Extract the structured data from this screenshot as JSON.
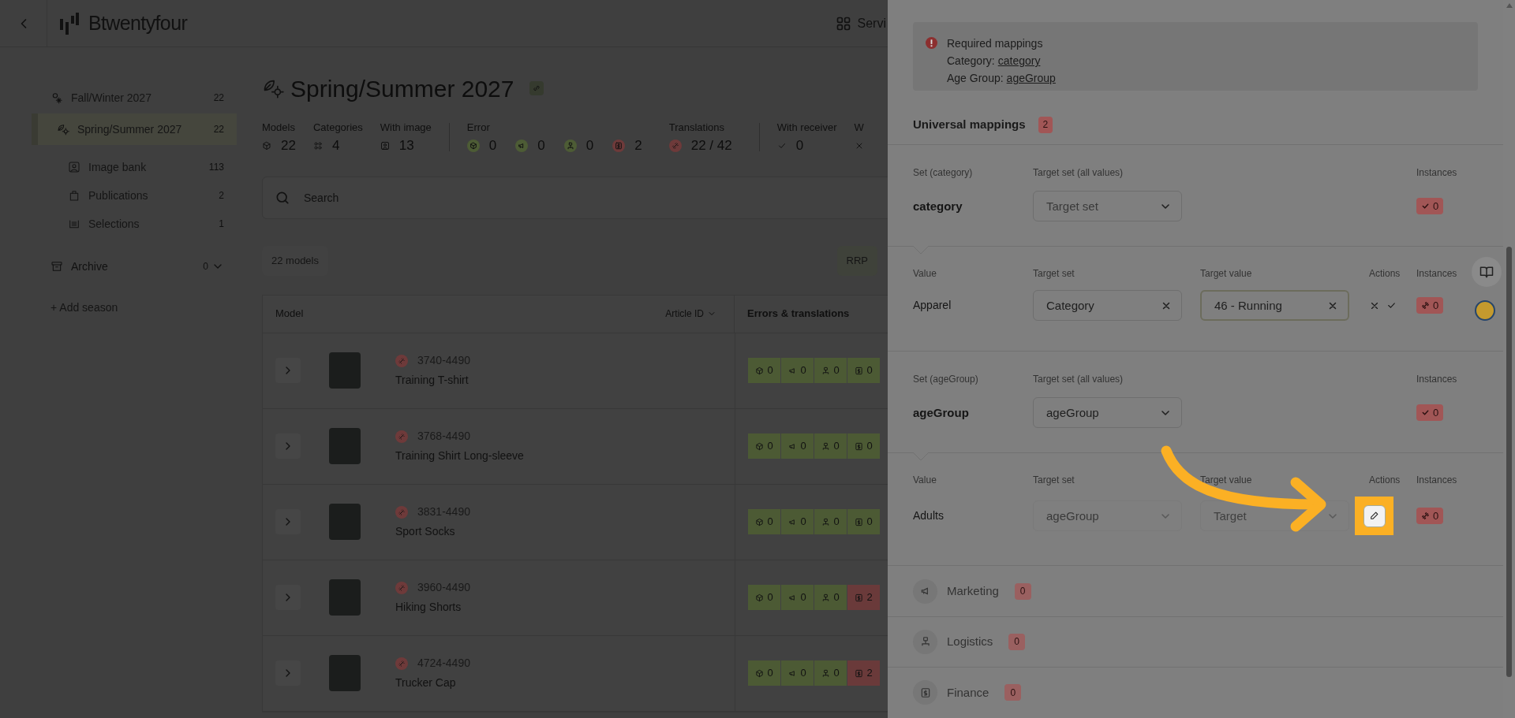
{
  "header": {
    "logo": "Btwentyfour",
    "services": "Servi"
  },
  "sidebar": {
    "seasons": [
      {
        "label": "Fall/Winter 2027",
        "count": "22",
        "selected": false
      },
      {
        "label": "Spring/Summer 2027",
        "count": "22",
        "selected": true
      }
    ],
    "sub_items": [
      {
        "label": "Image bank",
        "count": "113"
      },
      {
        "label": "Publications",
        "count": "2"
      },
      {
        "label": "Selections",
        "count": "1"
      }
    ],
    "archive": {
      "label": "Archive",
      "count": "0"
    },
    "add_season": "+ Add season"
  },
  "page": {
    "title": "Spring/Summer 2027",
    "stats": [
      {
        "kind": "count",
        "label": "Models",
        "value": "22"
      },
      {
        "kind": "count",
        "label": "Categories",
        "value": "4"
      },
      {
        "kind": "count",
        "label": "With image",
        "value": "13"
      },
      {
        "kind": "status",
        "label": "Error",
        "items": [
          {
            "value": "0",
            "color": "#4d5c35"
          },
          {
            "value": "0",
            "color": "#4d5c35"
          },
          {
            "value": "0",
            "color": "#4d5c35"
          },
          {
            "value": "2",
            "color": "#6e3a3a"
          }
        ]
      },
      {
        "kind": "status",
        "label": "Translations",
        "items": [
          {
            "value": "22 / 42",
            "color": "#6e3a3a"
          }
        ]
      },
      {
        "kind": "count",
        "label": "With receiver",
        "value": "0"
      },
      {
        "kind": "count",
        "label": "W"
      }
    ],
    "search": {
      "placeholder": "Search"
    },
    "model_count": "22 models",
    "price_button": "RRP",
    "table": {
      "columns": [
        "Model",
        "Article ID",
        "Errors & translations"
      ],
      "rows": [
        {
          "article_id": "3740-4490",
          "name": "Training T-shirt",
          "chips": [
            {
              "value": "0",
              "color": "#4c5a34"
            },
            {
              "value": "0",
              "color": "#4c5a34"
            },
            {
              "value": "0",
              "color": "#4c5a34"
            },
            {
              "value": "0",
              "color": "#4c5a34"
            }
          ]
        },
        {
          "article_id": "3768-4490",
          "name": "Training Shirt Long-sleeve",
          "chips": [
            {
              "value": "0",
              "color": "#4c5a34"
            },
            {
              "value": "0",
              "color": "#4c5a34"
            },
            {
              "value": "0",
              "color": "#4c5a34"
            },
            {
              "value": "0",
              "color": "#4c5a34"
            }
          ]
        },
        {
          "article_id": "3831-4490",
          "name": "Sport Socks",
          "chips": [
            {
              "value": "0",
              "color": "#4c5a34"
            },
            {
              "value": "0",
              "color": "#4c5a34"
            },
            {
              "value": "0",
              "color": "#4c5a34"
            },
            {
              "value": "0",
              "color": "#4c5a34"
            }
          ]
        },
        {
          "article_id": "3960-4490",
          "name": "Hiking Shorts",
          "chips": [
            {
              "value": "0",
              "color": "#4c5a34"
            },
            {
              "value": "0",
              "color": "#4c5a34"
            },
            {
              "value": "0",
              "color": "#4c5a34"
            },
            {
              "value": "2",
              "color": "#6a3a3a"
            }
          ]
        },
        {
          "article_id": "4724-4490",
          "name": "Trucker Cap",
          "chips": [
            {
              "value": "0",
              "color": "#4c5a34"
            },
            {
              "value": "0",
              "color": "#4c5a34"
            },
            {
              "value": "0",
              "color": "#4c5a34"
            },
            {
              "value": "2",
              "color": "#6a3a3a"
            }
          ]
        }
      ]
    }
  },
  "panel": {
    "alert": {
      "title": "Required mappings",
      "lines": [
        {
          "label": "Category:",
          "link": "category"
        },
        {
          "label": "Age Group:",
          "link": "ageGroup"
        }
      ]
    },
    "section": {
      "title": "Universal mappings",
      "count": "2"
    },
    "groups": [
      {
        "set_label": "Set (category)",
        "target_label": "Target set (all values)",
        "instances_label": "Instances",
        "name": "category",
        "target_set": {
          "kind": "select",
          "placeholder": "Target set"
        },
        "instances": "0",
        "value_headers": [
          "Value",
          "Target set",
          "Target value",
          "Actions",
          "Instances"
        ],
        "values": [
          {
            "value": "Apparel",
            "target_set": {
              "kind": "clearable",
              "value": "Category",
              "disabled": false,
              "focused": false
            },
            "target_value": {
              "kind": "clearable",
              "value": "46 - Running",
              "disabled": false,
              "focused": true
            },
            "editing": true,
            "highlighted": false,
            "instances": "0"
          }
        ]
      },
      {
        "set_label": "Set (ageGroup)",
        "target_label": "Target set (all values)",
        "instances_label": "Instances",
        "name": "ageGroup",
        "target_set": {
          "kind": "select",
          "value": "ageGroup"
        },
        "instances": "0",
        "value_headers": [
          "Value",
          "Target set",
          "Target value",
          "Actions",
          "Instances"
        ],
        "values": [
          {
            "value": "Adults",
            "target_set": {
              "kind": "select",
              "value": "ageGroup",
              "disabled": true,
              "focused": false
            },
            "target_value": {
              "kind": "select",
              "placeholder": "Target",
              "disabled": true,
              "focused": false
            },
            "editing": false,
            "highlighted": true,
            "instances": "0"
          }
        ]
      }
    ],
    "categories": [
      {
        "label": "Marketing",
        "count": "0"
      },
      {
        "label": "Logistics",
        "count": "0"
      },
      {
        "label": "Finance",
        "count": "0"
      }
    ]
  }
}
